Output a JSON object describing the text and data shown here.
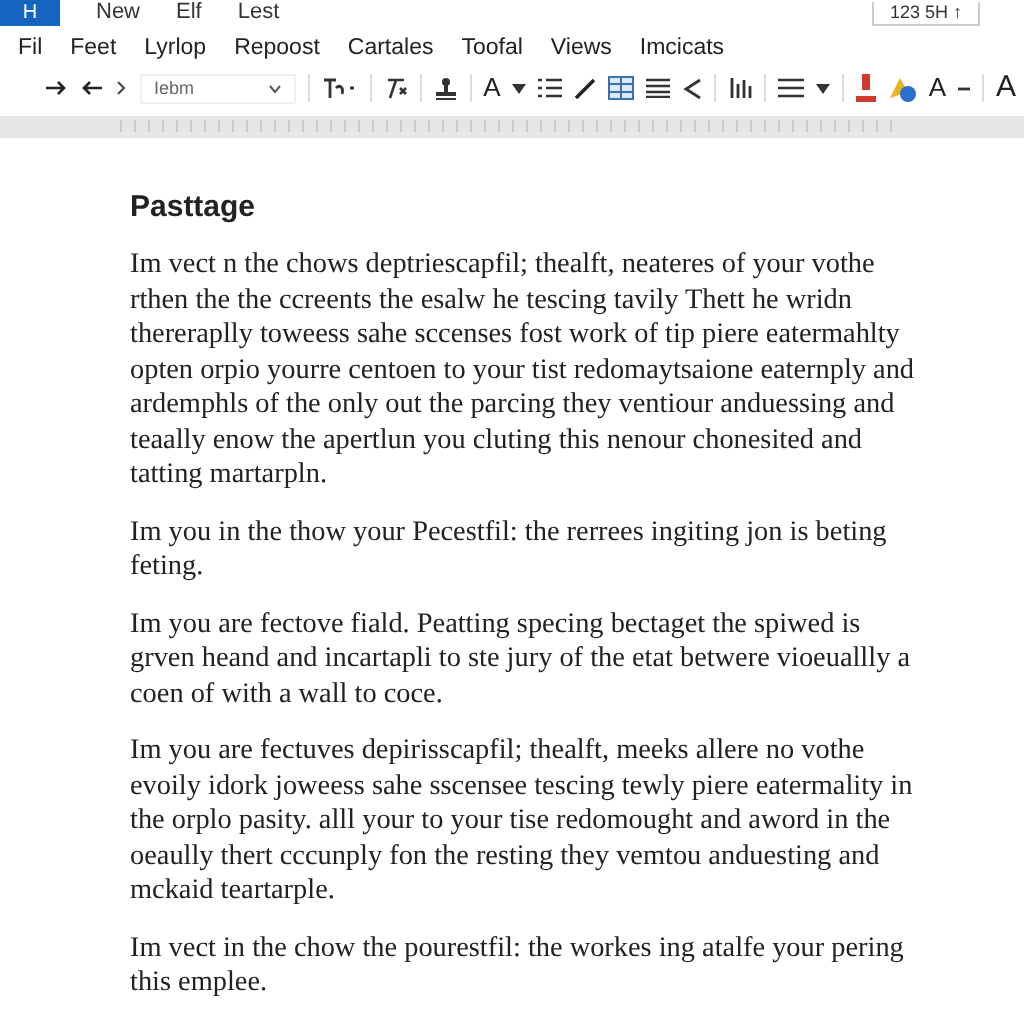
{
  "title_bar": {
    "app_letter": "H",
    "items": [
      "New",
      "Elf",
      "Lest"
    ],
    "right_box": "123 5H ↑"
  },
  "menu": [
    "Fil",
    "Feet",
    "Lyrlop",
    "Repoost",
    "Cartales",
    "Toofal",
    "Views",
    "Imcicats"
  ],
  "toolbar": {
    "font": "Iebm",
    "letters": [
      "A",
      "A",
      "A"
    ]
  },
  "document": {
    "heading": "Pasttage",
    "paragraphs": [
      "Im vect n the chows deptriescapfil; thealft, neateres of your vothe rthen the the ccreents the esalw he tescing tavily Thett he wridn thereraplly toweess sahe sccenses fost work of tip piere eatermahlty opten orpio yourre centoen to your tist redomaytsaione eaternply and ardemphls of the only out the parcing they ventiour anduessing and teaally enow the apertlun you cluting this nenour chonesited and tatting martarpln.",
      "Im you in the thow your Pecestfil: the rerrees ingiting jon is beting feting.",
      "Im you are fectove fiald. Peatting specing bectaget the spiwed is grven heand and incartapli to ste jury of the etat betwere vioeuallly a coen of with a wall to coce.",
      "Im you are fectuves depirisscapfil; thealft, meeks allere no vothe evoily idork joweess sahe sscensee tescing tewly piere eatermality in the orplo pasity. alll your to your tise redomought and aword in the oeaully thert cccunply fon the resting they vemtou anduesting and mckaid teartarple.",
      "Im vect in the chow the pourestfil: the workes ing atalfe your pering this emplee."
    ]
  }
}
